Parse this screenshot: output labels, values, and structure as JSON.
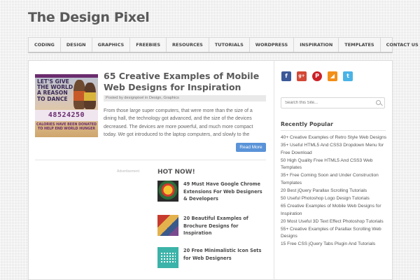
{
  "site": {
    "title": "The Design Pixel"
  },
  "nav": {
    "items": [
      "Coding",
      "Design",
      "Graphics",
      "Freebies",
      "Resources",
      "Tutorials",
      "WordPress",
      "Inspiration",
      "Templates",
      "Contact Us"
    ]
  },
  "post": {
    "thumb_text": "LET'S GIVE THE WORLD A REASON TO DANCE",
    "thumb_number": "48524250",
    "thumb_caption": "CALORIES HAVE BEEN DONATED TO HELP END WORLD HUNGER",
    "title": "65 Creative Examples of Mobile Web Designs for Inspiration",
    "meta": "Posted by designpixel in Design, Graphics",
    "excerpt": "From those large super computers, that were more than the size of a dining hall, the technology got advanced, and the size of the devices decreased. The devices are more powerful, and much more compact today. We got introduced to the laptop computers, and slowly to the",
    "read_more": "Read More"
  },
  "ad_label": "Advertisement",
  "hot": {
    "title": "HOT NOW!",
    "items": [
      "49 Must Have Google Chrome Extensions For Web Designers & Developers",
      "20 Beautiful Examples of Brochure Designs for Inspiration",
      "20 Free Minimalistic Icon Sets for Web Designers"
    ]
  },
  "social": {
    "icons": [
      "facebook-icon",
      "google-plus-icon",
      "pinterest-icon",
      "rss-icon",
      "twitter-icon"
    ]
  },
  "search": {
    "placeholder": "Search this Site..."
  },
  "popular": {
    "title": "Recently Popular",
    "items": [
      "40+ Creative Examples of Retro Style Web Designs",
      "35+ Useful HTML5 And CSS3 Dropdown Menu for Free Download",
      "50 High Quality Free HTML5 And CSS3 Web Templates",
      "35+ Free Coming Soon and Under Construction Templates",
      "20 Best jQuery Parallax Scrolling Tutorials",
      "50 Useful Photoshop Logo Design Tutorials",
      "65 Creative Examples of Mobile Web Designs for Inspiration",
      "20 Most Useful 3D Text Effect Photoshop Tutorials",
      "55+ Creative Examples of Parallax Scrolling Web Designs",
      "15 Free CSS jQuery Tabs Plugin And Tutorials"
    ]
  }
}
